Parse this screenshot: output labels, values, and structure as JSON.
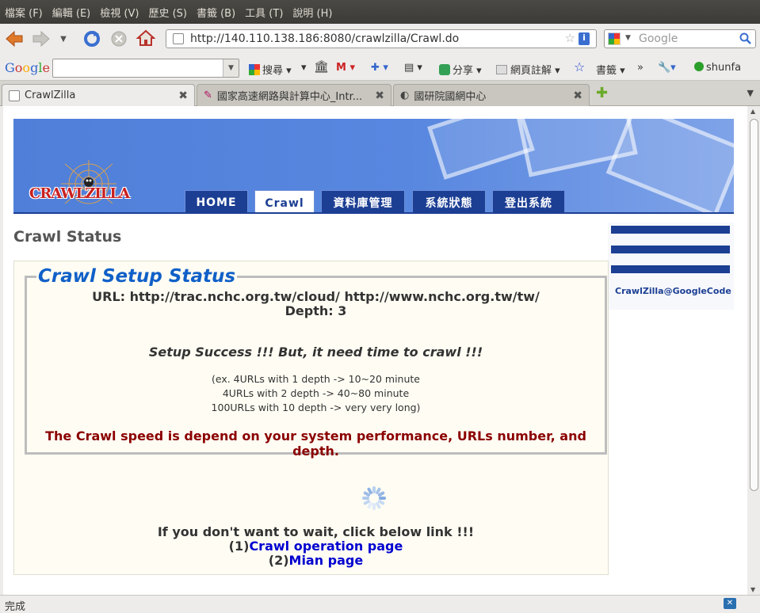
{
  "menubar": {
    "items": [
      "檔案 (F)",
      "編輯 (E)",
      "檢視 (V)",
      "歷史 (S)",
      "書籤 (B)",
      "工具 (T)",
      "說明 (H)"
    ]
  },
  "navbar": {
    "url": "http://140.110.138.186:8080/crawlzilla/Crawl.do",
    "search_placeholder": "Google"
  },
  "google_toolbar": {
    "logo": "Google",
    "search_label": "搜尋",
    "share_label": "分享",
    "annotate_label": "網頁註解",
    "bookmarks_label": "書籤",
    "more_label": "»",
    "user": "shunfa"
  },
  "tabs": [
    {
      "label": "CrawlZilla",
      "active": true
    },
    {
      "label": "國家高速網路與計算中心_Intr...",
      "active": false
    },
    {
      "label": "國研院國網中心",
      "active": false
    }
  ],
  "page": {
    "logo_text": "CRAWLZILLA",
    "nav": [
      "HOME",
      "Crawl",
      "資料庫管理",
      "系統狀態",
      "登出系統"
    ],
    "active_nav": "Crawl",
    "title": "Crawl Status",
    "legend": "Crawl Setup Status",
    "url_line": "URL: http://trac.nchc.org.tw/cloud/ http://www.nchc.org.tw/tw/",
    "depth_line": "Depth: 3",
    "success_line": "Setup Success !!! But, it need time to crawl !!!",
    "estimates": [
      "(ex. 4URLs with 1 depth -> 10~20 minute",
      "4URLs with 2 depth -> 40~80 minute",
      "100URLs with 10 depth -> very very long)"
    ],
    "speed_note": "The Crawl speed is depend on your system performance, URLs number, and depth.",
    "wait_line": "If you don't want to wait, click below link !!!",
    "link1_prefix": "(1)",
    "link1_label": "Crawl operation page",
    "link2_prefix": "(2)",
    "link2_label": "Mian page",
    "sidebar_link": "CrawlZilla@GoogleCode"
  },
  "status": "完成",
  "colors": {
    "header_blue": "#4f7fd8",
    "nav_dark": "#1c3f94",
    "legend_blue": "#1060c8",
    "speed_red": "#8b0000",
    "link_blue": "#0000d0"
  }
}
